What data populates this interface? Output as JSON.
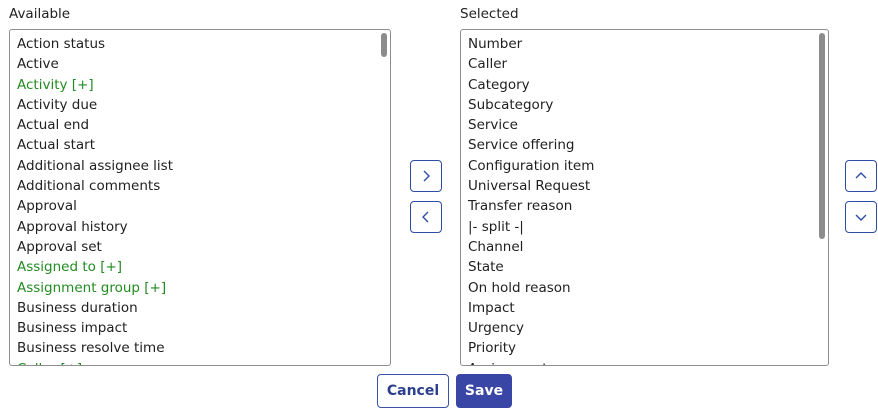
{
  "available": {
    "header": "Available",
    "items": [
      {
        "label": "Action status",
        "ref": false
      },
      {
        "label": "Active",
        "ref": false
      },
      {
        "label": "Activity [+]",
        "ref": true
      },
      {
        "label": "Activity due",
        "ref": false
      },
      {
        "label": "Actual end",
        "ref": false
      },
      {
        "label": "Actual start",
        "ref": false
      },
      {
        "label": "Additional assignee list",
        "ref": false
      },
      {
        "label": "Additional comments",
        "ref": false
      },
      {
        "label": "Approval",
        "ref": false
      },
      {
        "label": "Approval history",
        "ref": false
      },
      {
        "label": "Approval set",
        "ref": false
      },
      {
        "label": "Assigned to [+]",
        "ref": true
      },
      {
        "label": "Assignment group [+]",
        "ref": true
      },
      {
        "label": "Business duration",
        "ref": false
      },
      {
        "label": "Business impact",
        "ref": false
      },
      {
        "label": "Business resolve time",
        "ref": false
      },
      {
        "label": "Caller [+]",
        "ref": true
      }
    ]
  },
  "selected": {
    "header": "Selected",
    "items": [
      "Number",
      "Caller",
      "Category",
      "Subcategory",
      "Service",
      "Service offering",
      "Configuration item",
      "Universal Request",
      "Transfer reason",
      "|- split -|",
      "Channel",
      "State",
      "On hold reason",
      "Impact",
      "Urgency",
      "Priority",
      "Assignment group"
    ]
  },
  "buttons": {
    "cancel_label": "Cancel",
    "save_label": "Save"
  },
  "icons": {
    "add": "chevron-right-icon",
    "remove": "chevron-left-icon",
    "move_up": "chevron-up-icon",
    "move_down": "chevron-down-icon"
  },
  "colors": {
    "reference_field": "#228b22",
    "accent": "#3a46a6"
  }
}
